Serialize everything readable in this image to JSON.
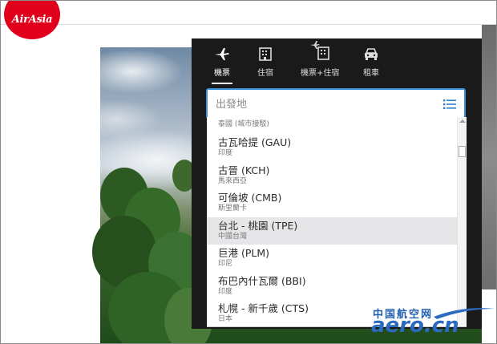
{
  "brand": {
    "logo_text": "AirAsia",
    "color": "#e0001b"
  },
  "tabs": [
    {
      "label": "機票",
      "icon": "airplane-icon",
      "active": true
    },
    {
      "label": "住宿",
      "icon": "hotel-icon",
      "active": false
    },
    {
      "label": "機票+住宿",
      "icon": "flight-hotel-icon",
      "active": false
    },
    {
      "label": "租車",
      "icon": "car-icon",
      "active": false
    }
  ],
  "search": {
    "placeholder": "出發地",
    "list_icon": "list-icon"
  },
  "dropdown": {
    "partial_item": {
      "sub": "泰國 (城市接駁)"
    },
    "items": [
      {
        "name": "古瓦哈提 (GAU)",
        "sub": "印度"
      },
      {
        "name": "古晉 (KCH)",
        "sub": "馬來西亞"
      },
      {
        "name": "可倫坡 (CMB)",
        "sub": "斯里蘭卡"
      },
      {
        "name": "台北 - 桃園 (TPE)",
        "sub": "中國台灣"
      },
      {
        "name": "巨港 (PLM)",
        "sub": "印尼"
      },
      {
        "name": "布巴內什瓦爾 (BBI)",
        "sub": "印度"
      },
      {
        "name": "札幌 - 新千歲 (CTS)",
        "sub": "日本"
      }
    ],
    "highlight_index": 3
  },
  "watermark": {
    "cn": "中国航空网",
    "en": "aero.cn"
  }
}
